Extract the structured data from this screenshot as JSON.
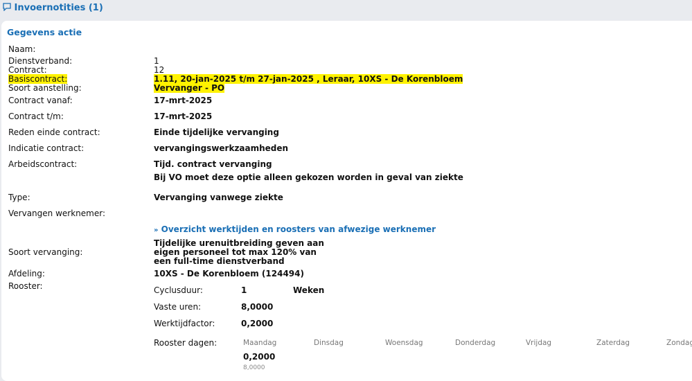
{
  "header": {
    "notes_label": "Invoernotities (1)"
  },
  "section": {
    "title": "Gegevens actie"
  },
  "fields": {
    "naam": {
      "label": "Naam:"
    },
    "dienstverband": {
      "label": "Dienstverband:",
      "value": "1"
    },
    "contract": {
      "label": "Contract:",
      "value": "12"
    },
    "basiscontract": {
      "label": "Basiscontract:",
      "value": "1.11, 20-jan-2025 t/m 27-jan-2025 , Leraar, 10XS - De Korenbloem"
    },
    "soort_aanstelling": {
      "label": "Soort aanstelling:",
      "value": "Vervanger - PO"
    },
    "contract_vanaf": {
      "label": "Contract vanaf:",
      "value": "17-mrt-2025"
    },
    "contract_tm": {
      "label": "Contract t/m:",
      "value": "17-mrt-2025"
    },
    "reden_einde": {
      "label": "Reden einde contract:",
      "value": "Einde tijdelijke vervanging"
    },
    "indicatie": {
      "label": "Indicatie contract:",
      "value": "vervangingswerkzaamheden"
    },
    "arbeidscontract": {
      "label": "Arbeidscontract:",
      "value": "Tijd. contract vervanging",
      "note": "Bij VO moet deze optie alleen gekozen worden in geval van ziekte"
    },
    "type": {
      "label": "Type:",
      "value": "Vervanging vanwege ziekte"
    },
    "vervangen": {
      "label": "Vervangen werknemer:",
      "link": "Overzicht werktijden en roosters van afwezige werknemer"
    },
    "soort_vervanging": {
      "label": "Soort vervanging:",
      "value_lines": [
        "Tijdelijke urenuitbreiding geven aan",
        "eigen personeel tot max 120% van",
        "een full-time dienstverband"
      ]
    },
    "afdeling": {
      "label": "Afdeling:",
      "value": "10XS - De Korenbloem (124494)"
    },
    "rooster": {
      "label": "Rooster:",
      "cyclusduur": {
        "label": "Cyclusduur:",
        "value": "1",
        "unit": "Weken"
      },
      "vaste_uren": {
        "label": "Vaste uren:",
        "value": "8,0000"
      },
      "werktijdfactor": {
        "label": "Werktijdfactor:",
        "value": "0,2000"
      },
      "dagen": {
        "label": "Rooster dagen:",
        "days": [
          "Maandag",
          "Dinsdag",
          "Woensdag",
          "Donderdag",
          "Vrijdag",
          "Zaterdag",
          "Zondag"
        ],
        "maandag_factor": "0,2000",
        "maandag_uren": "8,0000"
      }
    }
  }
}
